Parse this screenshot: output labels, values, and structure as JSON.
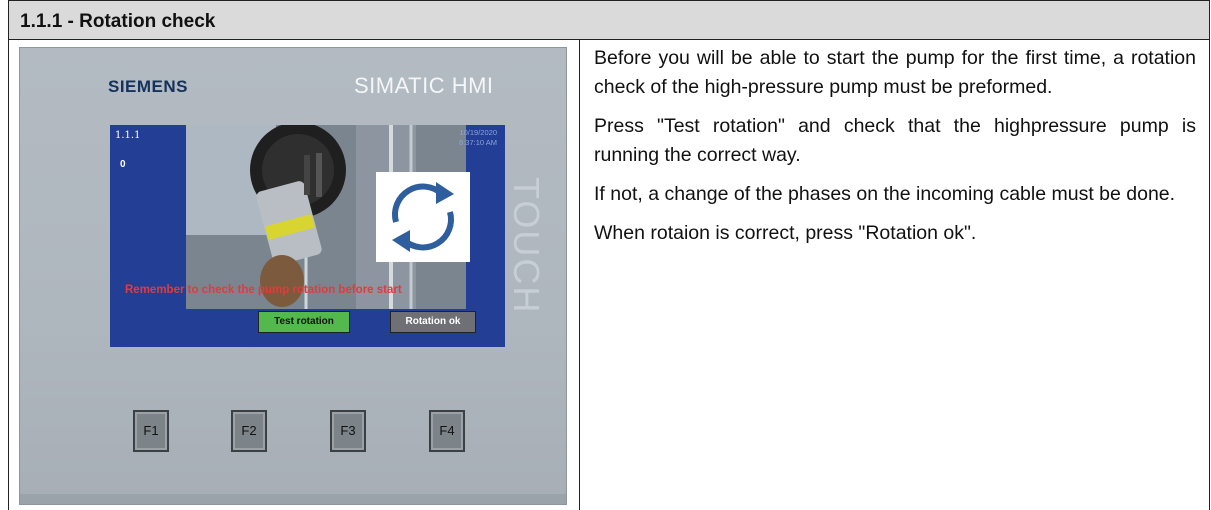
{
  "section_title": "1.1.1 - Rotation check",
  "hmi": {
    "brand": "SIEMENS",
    "model": "SIMATIC HMI",
    "side_label": "TOUCH",
    "screen": {
      "screen_id": "1.1.1",
      "counter": "0",
      "date": "10/19/2020",
      "time": "6:37:10 AM",
      "warning": "Remember to check the pump rotation before start",
      "test_button": "Test rotation",
      "ok_button": "Rotation ok"
    },
    "function_keys": [
      "F1",
      "F2",
      "F3",
      "F4"
    ]
  },
  "instructions": [
    "Before you will be able to start the pump for the first time, a rotation check of the high-pressure pump must be preformed.",
    "Press \"Test rotation\" and check that the highpressure pump is running the correct way.",
    "If not, a change of the phases on the incoming cable must be done.",
    "When rotaion is correct, press \"Rotation ok\"."
  ],
  "colors": {
    "screen_bg": "#233e95",
    "warning_text": "#e33a3a",
    "test_button": "#54b94c",
    "ok_button": "#6e7076",
    "header_bg": "#dadada"
  }
}
